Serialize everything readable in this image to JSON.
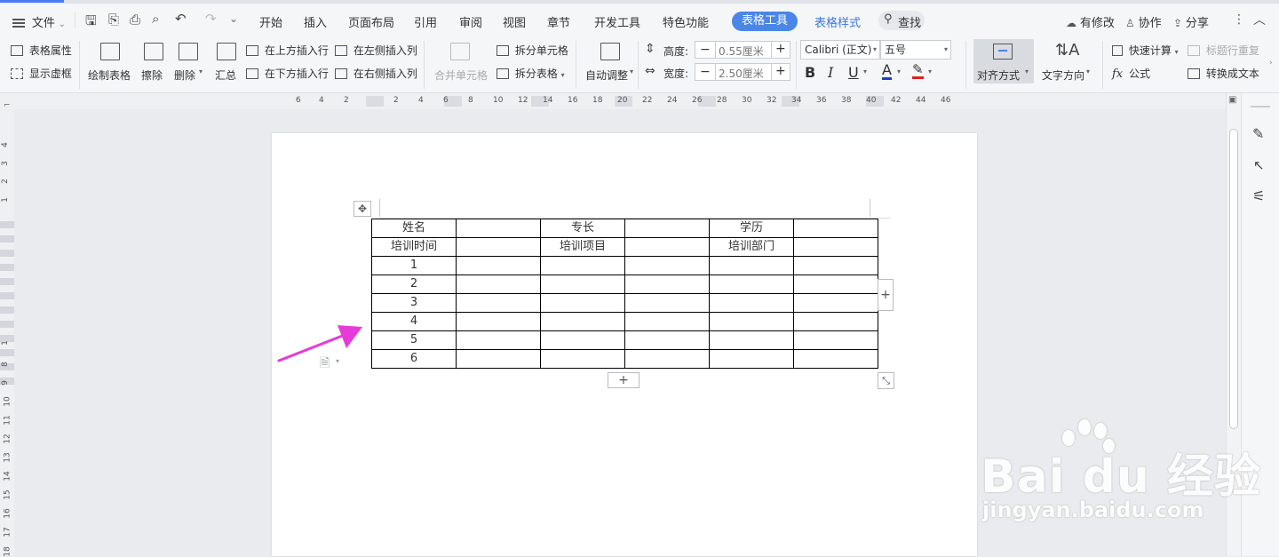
{
  "menu": {
    "file": "文件",
    "tabs": [
      "开始",
      "插入",
      "页面布局",
      "引用",
      "审阅",
      "视图",
      "章节",
      "开发工具",
      "特色功能"
    ],
    "active_tab": "表格工具",
    "style_tab": "表格样式",
    "search": "查找",
    "right": {
      "modified": "有修改",
      "collab": "协作",
      "share": "分享"
    }
  },
  "ribbon": {
    "table_props": "表格属性",
    "show_grid": "显示虚框",
    "draw_table": "绘制表格",
    "erase": "擦除",
    "delete": "删除",
    "summary": "汇总",
    "insert_above": "在上方插入行",
    "insert_below": "在下方插入行",
    "insert_left": "在左侧插入列",
    "insert_right": "在右侧插入列",
    "merge_cells": "合并单元格",
    "split_cells": "拆分单元格",
    "split_table": "拆分表格",
    "auto_fit": "自动调整",
    "height_label": "高度:",
    "height_value": "0.55厘米",
    "width_label": "宽度:",
    "width_value": "2.50厘米",
    "font_name": "Calibri (正文)",
    "font_size": "五号",
    "bold": "B",
    "italic": "I",
    "underline": "U",
    "font_color": "A",
    "align": "对齐方式",
    "text_direction": "文字方向",
    "quick_calc": "快速计算",
    "repeat_header": "标题行重复",
    "formula": "公式",
    "to_text": "转换成文本"
  },
  "ruler_h": [
    "6",
    "4",
    "2",
    "2",
    "4",
    "6",
    "8",
    "10",
    "12",
    "14",
    "16",
    "18",
    "20",
    "22",
    "24",
    "26",
    "28",
    "30",
    "32",
    "34",
    "36",
    "38",
    "40",
    "42",
    "44",
    "46"
  ],
  "ruler_v": [
    "4",
    "3",
    "2",
    "1",
    "1",
    "8",
    "9",
    "10",
    "11",
    "12",
    "13",
    "14",
    "15",
    "16",
    "17",
    "18"
  ],
  "table": {
    "rows": [
      [
        "姓名",
        "",
        "专长",
        "",
        "学历",
        ""
      ],
      [
        "培训时间",
        "",
        "培训项目",
        "",
        "培训部门",
        ""
      ],
      [
        "1",
        "",
        "",
        "",
        "",
        ""
      ],
      [
        "2",
        "",
        "",
        "",
        "",
        ""
      ],
      [
        "3",
        "",
        "",
        "",
        "",
        ""
      ],
      [
        "4",
        "",
        "",
        "",
        "",
        ""
      ],
      [
        "5",
        "",
        "",
        "",
        "",
        ""
      ],
      [
        "6",
        "",
        "",
        "",
        "",
        ""
      ]
    ]
  },
  "controls": {
    "plus": "+"
  },
  "colors": {
    "accent": "#4a86e8",
    "arrow": "#e83ad9",
    "font_color_bar": "#1f3fbf",
    "highlight_bar": "#e02020"
  },
  "watermark": {
    "brand": "Bai du 经验",
    "url": "jingyan.baidu.com"
  }
}
